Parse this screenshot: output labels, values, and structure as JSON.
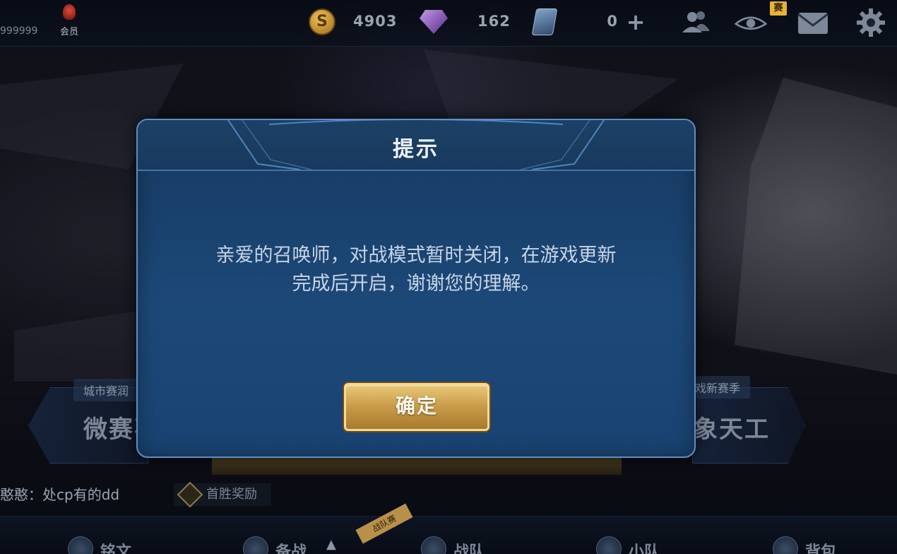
{
  "topbar": {
    "user_id": "999999",
    "vip_label": "会员",
    "gold_coins": "4903",
    "diamonds": "162",
    "vouchers": "0",
    "plus_symbol": "+",
    "spectate_badge": "赛",
    "coin_symbol": "S"
  },
  "modes": {
    "left_tag": "城市赛润",
    "left_title": "微赛事",
    "right_tag": "戏新赛季",
    "right_title": "象天工"
  },
  "chat": {
    "line": "憨憨：处cp有的dd"
  },
  "reward": {
    "label": "首胜奖励"
  },
  "bottom_nav": {
    "runes": "铭文",
    "prep": "备战",
    "team": "战队",
    "squad": "小队",
    "bag": "背包",
    "corner_badge": "战队赛"
  },
  "dialog": {
    "title": "提示",
    "message_line1": "亲爱的召唤师，对战模式暂时关闭，在游戏更新",
    "message_line2": "完成后开启，谢谢您的理解。",
    "confirm_label": "确定"
  },
  "colors": {
    "dialog_border": "#5d8ec4",
    "dialog_bg": "#1c4878",
    "button_gold": "#c79b48"
  }
}
